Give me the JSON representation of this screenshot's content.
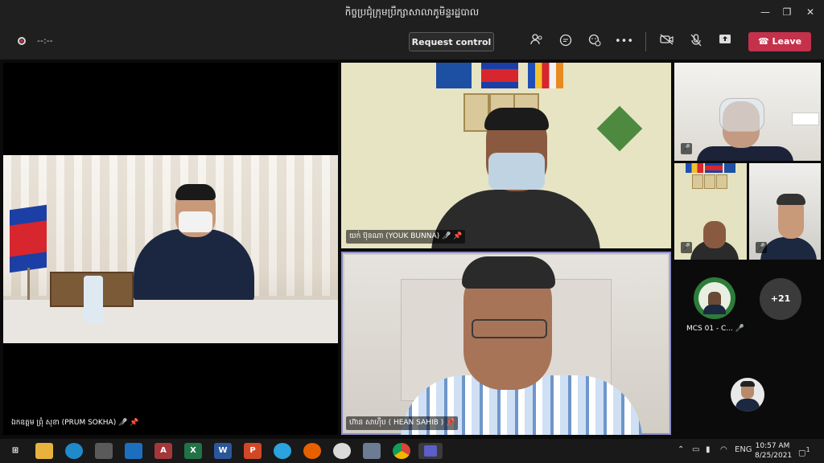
{
  "window": {
    "title": "កិច្ចប្រជុំក្រុមប្រឹក្សាសាលាភូមិន្ទរដ្ឋបាល",
    "minimize": "—",
    "maximize": "❐",
    "close": "✕"
  },
  "toolbar": {
    "timer": "--:--",
    "request_control": "Request control",
    "more": "•••",
    "leave": "Leave",
    "accent": "#c4314b"
  },
  "participants": {
    "p1": {
      "name": "ឯកឧត្តម ព្រុំ សុខា (PRUM SOKHA)"
    },
    "p2": {
      "name": "យក់ ប៊ុនណា (YOUK BUNNA)"
    },
    "p3": {
      "name": "ហ៊ាន សាហ៊ីប ( HEAN SAHIB )"
    },
    "p7": {
      "name": "MCS 01 - C..."
    },
    "overflow": "+21"
  },
  "taskbar": {
    "lang": "ENG",
    "time": "10:57 AM",
    "date": "8/25/2021",
    "notifications": "1"
  }
}
